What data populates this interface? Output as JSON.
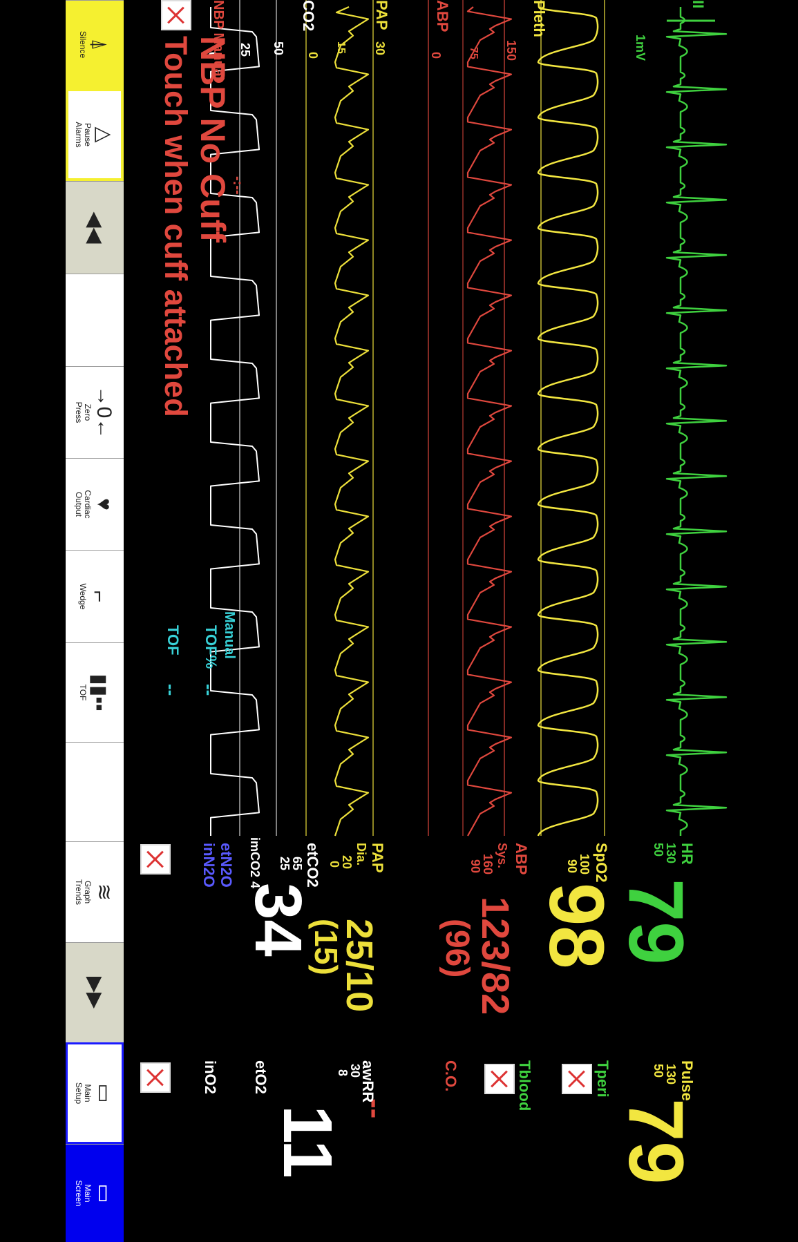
{
  "waves": {
    "ecg_gain": "1mV",
    "pleth_label": "Pleth",
    "abp_label": "ABP",
    "abp_scale": [
      "150",
      "75",
      "0"
    ],
    "pap_label": "PAP",
    "pap_scale": [
      "30",
      "15",
      "0"
    ],
    "co2_label": "CO2",
    "co2_scale": [
      "50",
      "25",
      "0"
    ],
    "co2_bottom_label": "imCO2",
    "co2_bottom_value": "4"
  },
  "nbp": {
    "label": "NBP Manual",
    "dashes": "-:--",
    "message_line1": "NBP No Cuff",
    "message_line2": "Touch when cuff attached"
  },
  "tof": {
    "manual_label": "Manual",
    "tof_pct_label": "TOF%",
    "tof_pct_value": "--",
    "tof_label": "TOF",
    "tof_value": "--"
  },
  "params": {
    "hr": {
      "label": "HR",
      "high": "130",
      "low": "50",
      "value": "79"
    },
    "spo2": {
      "label": "SpO2",
      "high": "100",
      "low": "90",
      "value": "98"
    },
    "abp": {
      "label": "ABP",
      "sub": "Sys.",
      "high": "160",
      "low": "90",
      "value": "123/82",
      "mean": "(96)"
    },
    "pap": {
      "label": "PAP",
      "sub": "Dia.",
      "high": "20",
      "low": "0",
      "value": "25/10",
      "mean": "(15)"
    },
    "etco2": {
      "label": "etCO2",
      "high": "65",
      "low": "25",
      "value": "34"
    },
    "etn2o": {
      "label": "etN2O"
    },
    "inn2o": {
      "label": "inN2O"
    },
    "pulse": {
      "label": "Pulse",
      "high": "130",
      "low": "50",
      "value": "79"
    },
    "tperi": {
      "label": "Tperi"
    },
    "tblood": {
      "label": "Tblood"
    },
    "co": {
      "label": "C.O.",
      "value": "--"
    },
    "awrr": {
      "label": "awRR",
      "high": "30",
      "low": "8",
      "value": "11"
    },
    "eto2": {
      "label": "etO2"
    },
    "ino2": {
      "label": "inO2"
    }
  },
  "toolbar": [
    {
      "icon": "⍋",
      "label": "Silence"
    },
    {
      "icon": "△",
      "label": "Pause\nAlarms"
    },
    {
      "icon": "◀◀",
      "label": ""
    },
    {
      "icon": "",
      "label": ""
    },
    {
      "icon": "→0←",
      "label": "Zero\nPress"
    },
    {
      "icon": "♥",
      "label": "Cardiac\nOutput"
    },
    {
      "icon": "⌐",
      "label": "Wedge"
    },
    {
      "icon": "▮▮▪▪",
      "label": "TOF"
    },
    {
      "icon": "",
      "label": ""
    },
    {
      "icon": "≋",
      "label": "Graph\nTrends"
    },
    {
      "icon": "▶▶",
      "label": ""
    },
    {
      "icon": "▭",
      "label": "Main\nSetup"
    },
    {
      "icon": "▭",
      "label": "Main\nScreen"
    }
  ],
  "colors": {
    "ecg": "#3fd13f",
    "pleth": "#f2e640",
    "abp": "#e0483e",
    "pap": "#ecdf3a",
    "co2": "#ffffff",
    "tof": "#38d2d8",
    "n2o": "#5a5aff"
  }
}
